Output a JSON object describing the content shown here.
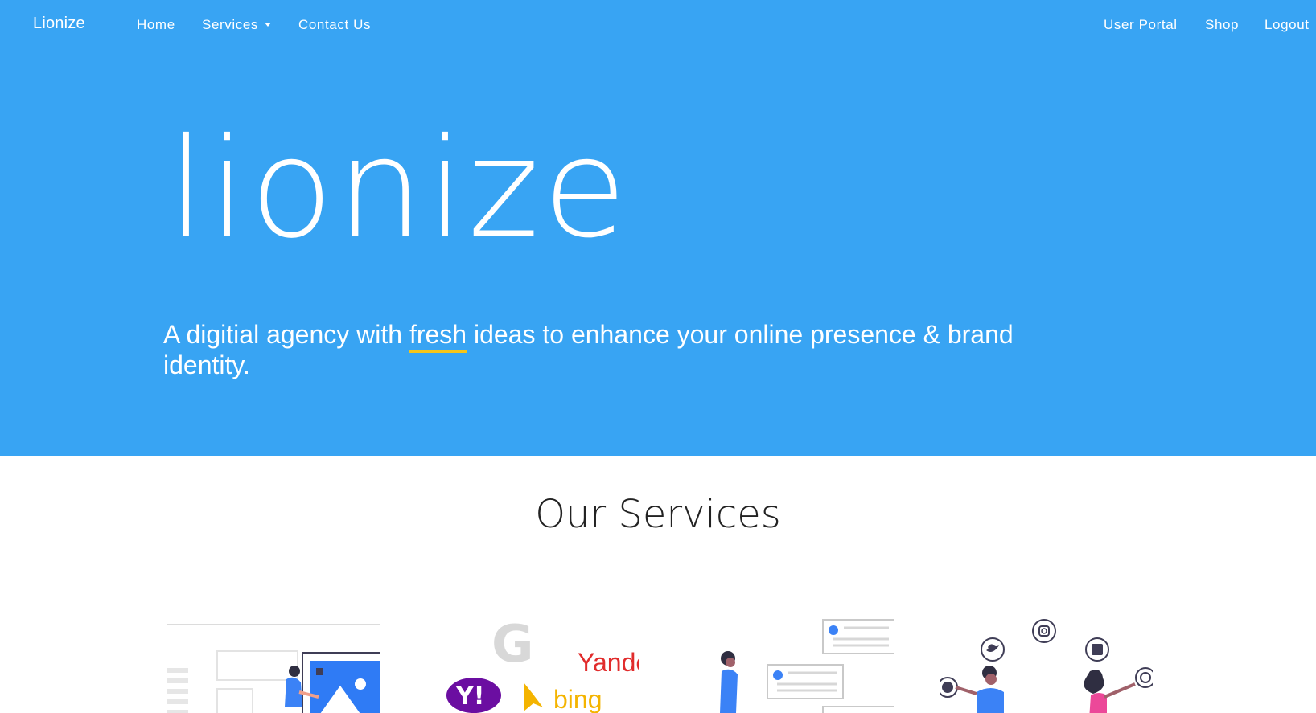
{
  "nav": {
    "brand": "Lionize",
    "left_links": [
      {
        "label": "Home"
      },
      {
        "label": "Services"
      },
      {
        "label": "Contact Us"
      }
    ],
    "right_links": [
      {
        "label": "User Portal"
      },
      {
        "label": "Shop"
      },
      {
        "label": "Logout"
      }
    ]
  },
  "hero": {
    "title": "lionize",
    "tagline_before": "A digitial agency with ",
    "tagline_highlight": "fresh",
    "tagline_after": " ideas to enhance your online presence & brand identity.",
    "bg_color": "#38a4f3",
    "highlight_color": "#f5c518"
  },
  "services": {
    "heading": "Our Services",
    "cards": [
      {
        "icon": "web-design-illustration-icon"
      },
      {
        "icon": "search-engines-illustration-icon",
        "logo_texts": [
          "Yandex",
          "bing",
          "Y!"
        ]
      },
      {
        "icon": "content-cards-illustration-icon"
      },
      {
        "icon": "social-media-illustration-icon"
      }
    ]
  }
}
